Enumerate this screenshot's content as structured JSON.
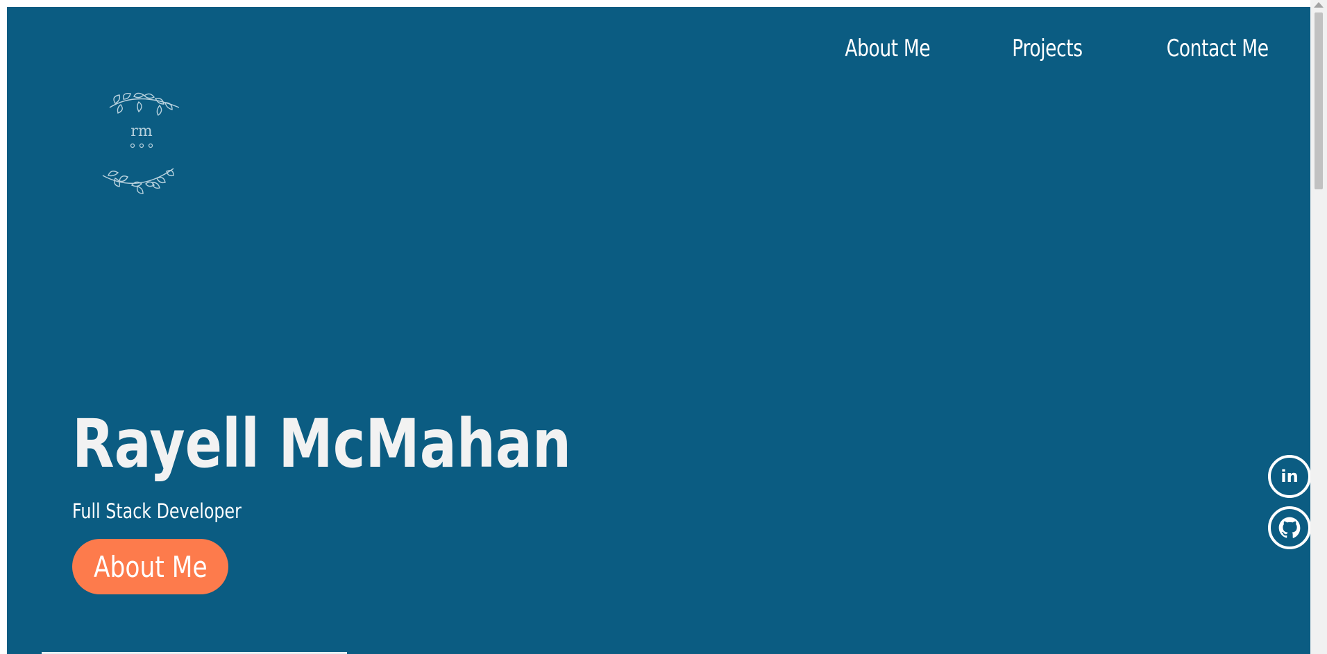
{
  "nav": {
    "items": [
      {
        "label": "About Me"
      },
      {
        "label": "Projects"
      },
      {
        "label": "Contact Me"
      }
    ]
  },
  "logo": {
    "monogram": "rm",
    "icon": "laurel-wreath-logo"
  },
  "hero": {
    "name": "Rayell McMahan",
    "subtitle": "Full Stack Developer",
    "cta_label": "About Me"
  },
  "social": {
    "linkedin_text": "in",
    "linkedin_icon": "linkedin-icon",
    "github_icon": "github-icon"
  },
  "colors": {
    "background": "#0b5c82",
    "accent": "#fd7b4c",
    "text": "#ffffff"
  }
}
